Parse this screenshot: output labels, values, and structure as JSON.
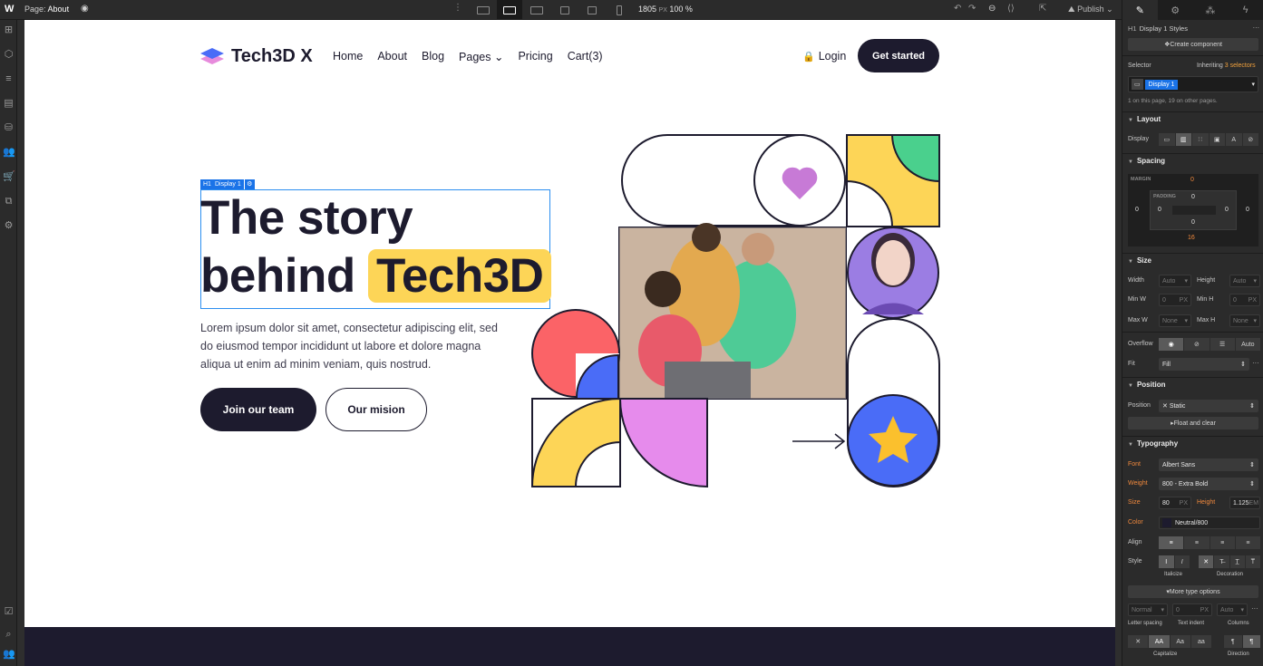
{
  "topbar": {
    "logo": "W",
    "page_label": "Page:",
    "page_name": "About",
    "width_value": "1805",
    "width_unit": "PX",
    "zoom": "100 %",
    "publish": "Publish"
  },
  "site": {
    "brand": "Tech3D X",
    "nav": [
      "Home",
      "About",
      "Blog",
      "Pages",
      "Pricing",
      "Cart(3)"
    ],
    "login": "Login",
    "get_started": "Get started",
    "selection_tag": "Display 1",
    "selection_tag_prefix": "H1",
    "hero_line1": "The story",
    "hero_line2a": "behind",
    "hero_line2b": "Tech3D",
    "hero_desc": "Lorem ipsum dolor sit amet, consectetur adipiscing elit, sed do eiusmod tempor incididunt ut labore et dolore magna aliqua ut enim ad minim veniam, quis nostrud.",
    "btn_join": "Join our team",
    "btn_mission": "Our mision"
  },
  "panel": {
    "styles_title": "Display 1 Styles",
    "styles_prefix": "H1",
    "create_component": "Create component",
    "selector_label": "Selector",
    "inheriting": "Inheriting",
    "inheriting_count": "3 selectors",
    "selector_chip": "Display 1",
    "selector_note": "1 on this page, 19 on other pages.",
    "layout": "Layout",
    "display_label": "Display",
    "spacing": "Spacing",
    "margin_label": "MARGIN",
    "padding_label": "PADDING",
    "margin_top": "0",
    "margin_left": "0",
    "margin_right": "0",
    "margin_bottom": "16",
    "padding_top": "0",
    "padding_left": "0",
    "padding_right": "0",
    "padding_bottom": "0",
    "size": "Size",
    "width_label": "Width",
    "width_val": "Auto",
    "height_label": "Height",
    "height_val": "Auto",
    "minw_label": "Min W",
    "minw_val": "0",
    "minh_label": "Min H",
    "minh_val": "0",
    "maxw_label": "Max W",
    "maxw_val": "None",
    "maxh_label": "Max H",
    "maxh_val": "None",
    "px_unit": "PX",
    "overflow_label": "Overflow",
    "overflow_auto": "Auto",
    "fit_label": "Fit",
    "fit_val": "Fill",
    "position": "Position",
    "position_label": "Position",
    "position_val": "Static",
    "float_clear": "Float and clear",
    "typography": "Typography",
    "font_label": "Font",
    "font_val": "Albert Sans",
    "weight_label": "Weight",
    "weight_val": "800 - Extra Bold",
    "size_label": "Size",
    "size_val": "80",
    "lh_label": "Height",
    "lh_val": "1.125",
    "lh_unit": "EM",
    "color_label": "Color",
    "color_val": "Neutral/800",
    "align_label": "Align",
    "style_label": "Style",
    "italicize": "Italicize",
    "decoration": "Decoration",
    "more_type": "More type options",
    "ls_val": "Normal",
    "ti_val": "0",
    "col_val": "Auto",
    "letter_spacing": "Letter spacing",
    "text_indent": "Text indent",
    "columns": "Columns",
    "capitalize": "Capitalize",
    "direction": "Direction",
    "cap_opts": [
      "✕",
      "AA",
      "Aa",
      "aa"
    ]
  },
  "colors": {
    "accent_blue": "#1a73e8",
    "dark_navy": "#1d1b2e",
    "highlight_yellow": "#fdd557",
    "orange_label": "#f0893d"
  }
}
